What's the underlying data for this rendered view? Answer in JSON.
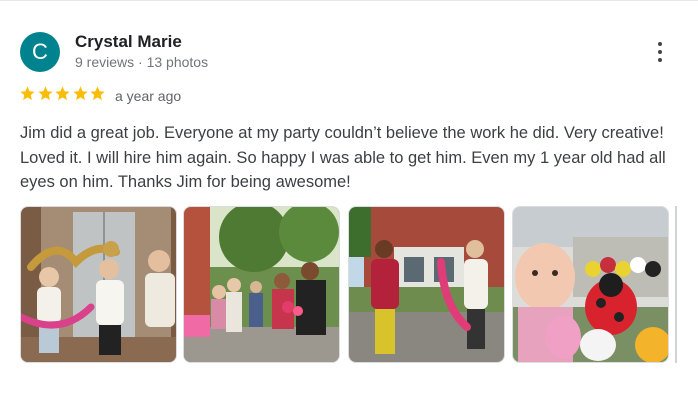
{
  "review": {
    "avatar_initial": "C",
    "avatar_color": "#00838f",
    "reviewer_name": "Crystal Marie",
    "reviewer_meta": "9 reviews · 13 photos",
    "rating": 5,
    "star_color": "#fbbc04",
    "time_ago": "a year ago",
    "text": "Jim did a great job. Everyone at my party couldn’t believe the work he did. Very creative! Loved it. I will hire him again. So happy I was able to get him. Even my 1 year old had all eyes on him. Thanks Jim for being awesome!"
  },
  "icons": {
    "more": "more-vert-icon",
    "star": "star-icon"
  },
  "photos": [
    {
      "name": "photo-girls-balloon-hats"
    },
    {
      "name": "photo-party-backyard-crowd"
    },
    {
      "name": "photo-balloon-artist-at-house"
    },
    {
      "name": "photo-baby-ladybug-balloon"
    }
  ]
}
